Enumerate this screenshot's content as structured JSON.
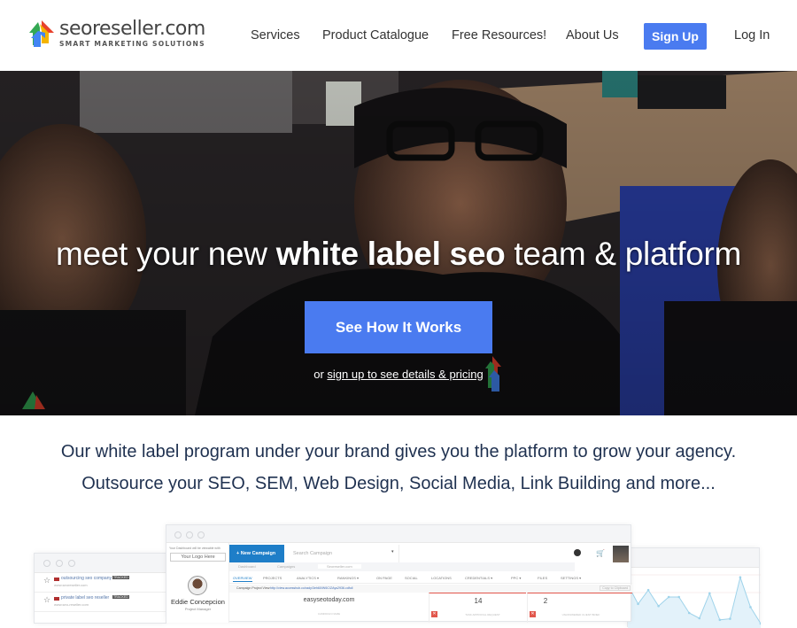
{
  "header": {
    "logo": {
      "name": "seoreseller.com",
      "tagline": "SMART MARKETING SOLUTIONS"
    },
    "nav": [
      {
        "label": "Services"
      },
      {
        "label": "Product Catalogue"
      },
      {
        "label": "Free Resources!"
      },
      {
        "label": "About Us"
      }
    ],
    "signup_label": "Sign Up",
    "login_label": "Log In"
  },
  "hero": {
    "title_pre": "meet your new ",
    "title_bold": "white label seo",
    "title_post": " team & platform",
    "cta_label": "See How It Works",
    "sub_prefix": "or ",
    "sub_link": "sign up to see details & pricing"
  },
  "intro": {
    "line1": "Our white label program under your brand gives you the platform to grow your agency.",
    "line2": "Outsource your SEO, SEM, Web Design, Social Media, Link Building and more..."
  },
  "dashboard": {
    "left_window": {
      "items": [
        {
          "label": "outsourcing seo company",
          "url": "www.seoreseller.com",
          "badge": "TRACKED"
        },
        {
          "label": "private label seo reseller",
          "url": "www.seo-reseller.com",
          "badge": "TRACKED"
        }
      ]
    },
    "main_window": {
      "sidebar_note": "Your Dashboard will be viewable with",
      "logo_placeholder": "Your Logo Here",
      "user_name": "Eddie Concepcion",
      "user_role": "Project Manager",
      "new_campaign_label": "+ New Campaign",
      "search_placeholder": "Search Campaign",
      "breadcrumb": [
        "Dashboard",
        "Campaigns",
        "Seoreseller.com"
      ],
      "tabs": [
        {
          "label": "OVERVIEW",
          "active": true
        },
        {
          "label": "PROJECTS"
        },
        {
          "label": "ANALYTICS ▾"
        },
        {
          "label": "RANKINGS ▾"
        },
        {
          "label": "ON PAGE"
        },
        {
          "label": "SOCIAL"
        },
        {
          "label": "LOCATIONS"
        },
        {
          "label": "CREDENTIALS ▾"
        },
        {
          "label": "PPC ▾"
        },
        {
          "label": "FILES"
        },
        {
          "label": "SETTINGS ▾"
        }
      ],
      "project_view_label": "Campaign Project View:",
      "project_view_url": "http://view.accesshub.co/rady/3eh60/W6C/ZAys2936.cdfoll",
      "copy_label": "Copy to Clipboard",
      "campaign_name": "easyseotoday.com",
      "campaign_name_caption": "CAMPAIGN NAME",
      "stat1_value": "14",
      "stat1_caption": "TASK APPROVAL REQUEST",
      "stat2_value": "2",
      "stat2_caption": "UNANSWERED CLIENT BRIEF",
      "cart_count": "0"
    },
    "right_window": {
      "chart_points": [
        0.78,
        0.42,
        0.68,
        0.38,
        0.55,
        0.55,
        0.25,
        0.15,
        0.62,
        0.12,
        0.14,
        0.92,
        0.36,
        0.05
      ]
    }
  },
  "colors": {
    "accent": "#4a7bf0",
    "heading_text": "#1f3150",
    "dashboard_blue": "#1e7ec8",
    "alert_red": "#e2574c"
  }
}
